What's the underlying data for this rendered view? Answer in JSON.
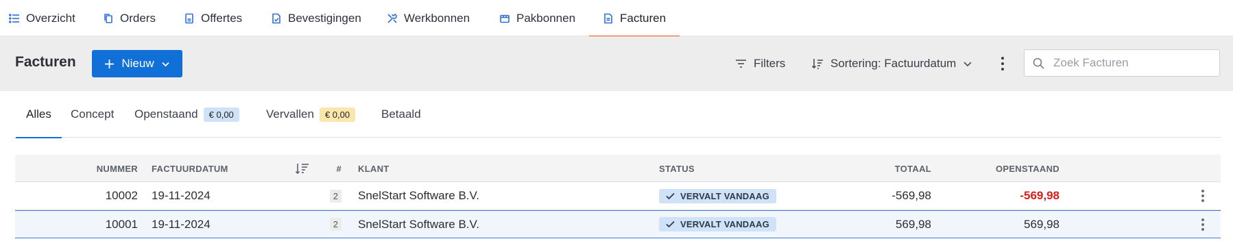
{
  "nav": {
    "tabs": [
      {
        "label": "Overzicht"
      },
      {
        "label": "Orders"
      },
      {
        "label": "Offertes"
      },
      {
        "label": "Bevestigingen"
      },
      {
        "label": "Werkbonnen"
      },
      {
        "label": "Pakbonnen"
      },
      {
        "label": "Facturen"
      }
    ],
    "active": "Facturen"
  },
  "toolbar": {
    "title": "Facturen",
    "new_label": "Nieuw",
    "filters_label": "Filters",
    "sort_label": "Sortering: Factuurdatum",
    "search_placeholder": "Zoek Facturen"
  },
  "subtabs": [
    {
      "label": "Alles",
      "active": true
    },
    {
      "label": "Concept"
    },
    {
      "label": "Openstaand",
      "badge": "€ 0,00"
    },
    {
      "label": "Vervallen",
      "badge": "€ 0,00"
    },
    {
      "label": "Betaald"
    }
  ],
  "table": {
    "columns": {
      "nummer": "NUMMER",
      "factuurdatum": "FACTUURDATUM",
      "count": "#",
      "klant": "KLANT",
      "status": "STATUS",
      "totaal": "TOTAAL",
      "openstaand": "OPENSTAAND"
    },
    "rows": [
      {
        "nummer": "10002",
        "factuurdatum": "19-11-2024",
        "count": "2",
        "klant": "SnelStart Software B.V.",
        "status": "VERVALT VANDAAG",
        "totaal": "-569,98",
        "openstaand": "-569,98"
      },
      {
        "nummer": "10001",
        "factuurdatum": "19-11-2024",
        "count": "2",
        "klant": "SnelStart Software B.V.",
        "status": "VERVALT VANDAAG",
        "totaal": "569,98",
        "openstaand": "569,98"
      }
    ]
  },
  "colors": {
    "primary": "#1170d8",
    "nav_active_underline": "#e8541e",
    "negative": "#d81b1b",
    "status_badge_bg": "#cfe2f8",
    "pill_blue": "#cfe2f8",
    "pill_yellow": "#fbe7ad"
  }
}
